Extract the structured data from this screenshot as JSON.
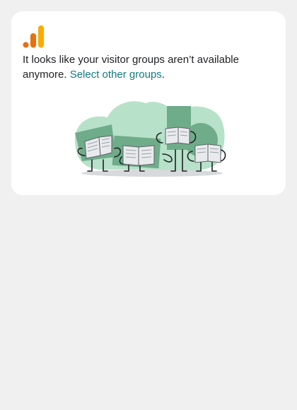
{
  "card": {
    "logo_icon": "analytics-bar-logo",
    "message_text": "It looks like your visitor groups aren’t available anymore.",
    "link_text": "Select other groups",
    "trailing_punct": ".",
    "illustration": "people-reading-newspapers",
    "colors": {
      "logo_orange": "#e8710a",
      "logo_yellow": "#f9ab00",
      "link": "#137a7f",
      "blob_light": "#b7e2c9",
      "shape_green": "#6fac8a"
    }
  }
}
